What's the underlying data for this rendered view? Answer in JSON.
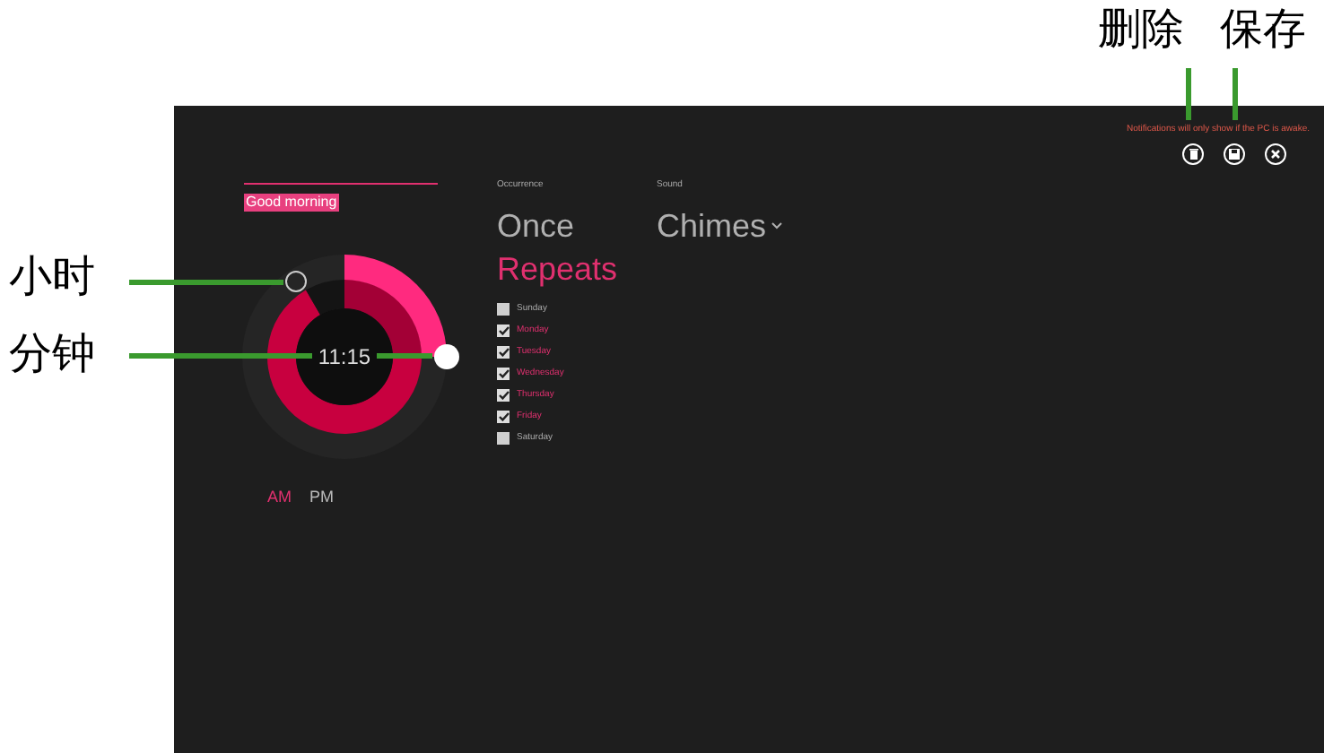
{
  "annotations": {
    "top": [
      {
        "label": "删除"
      },
      {
        "label": "保存"
      }
    ],
    "left": [
      {
        "label": "小时"
      },
      {
        "label": "分钟"
      }
    ]
  },
  "notice": "Notifications will only show if the PC is awake.",
  "alarm": {
    "name": "Good morning",
    "time": "11:15",
    "meridiem": [
      {
        "label": "AM",
        "selected": true
      },
      {
        "label": "PM",
        "selected": false
      }
    ]
  },
  "occurrence": {
    "label": "Occurrence",
    "options": [
      {
        "label": "Once",
        "selected": false
      },
      {
        "label": "Repeats",
        "selected": true
      }
    ],
    "days": [
      {
        "label": "Sunday",
        "checked": false
      },
      {
        "label": "Monday",
        "checked": true
      },
      {
        "label": "Tuesday",
        "checked": true
      },
      {
        "label": "Wednesday",
        "checked": true
      },
      {
        "label": "Thursday",
        "checked": true
      },
      {
        "label": "Friday",
        "checked": true
      },
      {
        "label": "Saturday",
        "checked": false
      }
    ]
  },
  "sound": {
    "label": "Sound",
    "value": "Chimes"
  }
}
